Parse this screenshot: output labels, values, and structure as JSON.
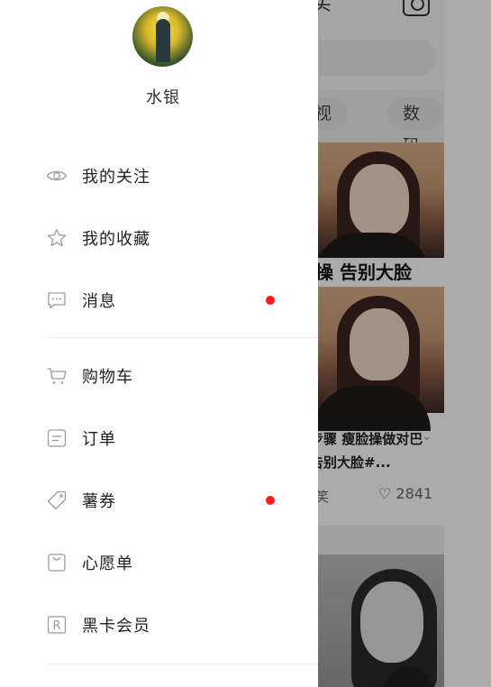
{
  "background": {
    "top_title": "买",
    "categories": [
      "影视",
      "数码"
    ],
    "card": {
      "caption": "脸操 告别大脸",
      "title": "步骤 瘦脸操做对巴告别大脸#...",
      "user": "笑",
      "likes": "♡ 2841"
    }
  },
  "drawer": {
    "username": "水银",
    "notification_color": "#ff1a1a",
    "group1": [
      {
        "label": "我的关注",
        "icon": "eye-icon",
        "badge": false
      },
      {
        "label": "我的收藏",
        "icon": "star-icon",
        "badge": false
      },
      {
        "label": "消息",
        "icon": "chat-bubble-icon",
        "badge": true
      }
    ],
    "group2": [
      {
        "label": "购物车",
        "icon": "cart-icon",
        "badge": false
      },
      {
        "label": "订单",
        "icon": "order-icon",
        "badge": false
      },
      {
        "label": "薯券",
        "icon": "coupon-tag-icon",
        "badge": true
      },
      {
        "label": "心愿单",
        "icon": "wishlist-bag-icon",
        "badge": false
      },
      {
        "label": "黑卡会员",
        "icon": "member-r-icon",
        "badge": false
      }
    ]
  }
}
